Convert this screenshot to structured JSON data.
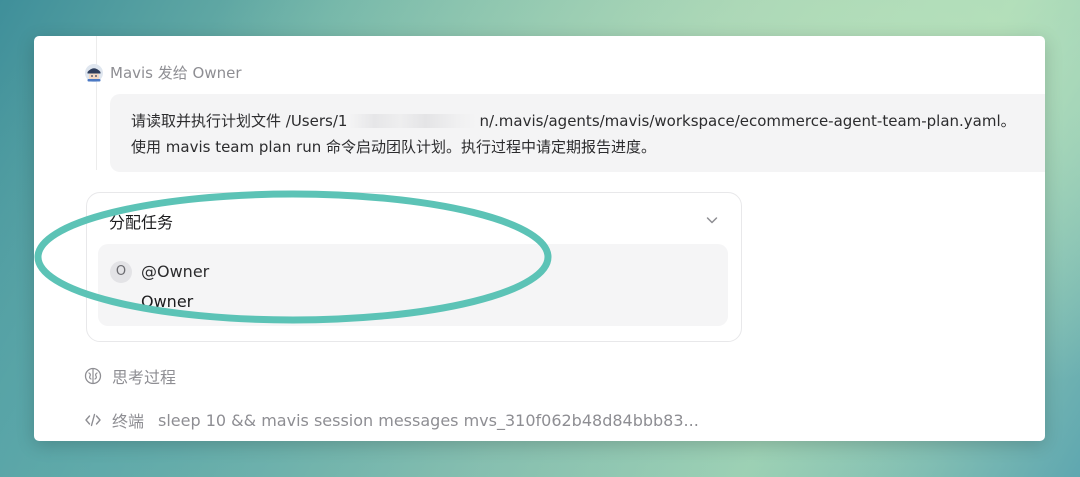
{
  "message": {
    "sender_header": "Mavis 发给 Owner",
    "line1_prefix": "请读取并执行计划文件 /Users/1",
    "line1_suffix": "n/.mavis/agents/mavis/workspace/ecommerce-agent-team-plan.yaml。",
    "line2": "使用 mavis team plan run 命令启动团队计划。执行过程中请定期报告进度。"
  },
  "task_card": {
    "title": "分配任务",
    "assignee": {
      "avatar_letter": "O",
      "handle": "@Owner",
      "name": "Owner"
    }
  },
  "steps": {
    "thinking_label": "思考过程",
    "terminal_label": "终端",
    "terminal_command": "sleep 10 && mavis session messages mvs_310f062b48d84bbb83..."
  },
  "colors": {
    "annotation_ellipse": "#5cc3b6",
    "bubble_bg": "#f4f4f5",
    "muted_text": "#8e8e93"
  }
}
